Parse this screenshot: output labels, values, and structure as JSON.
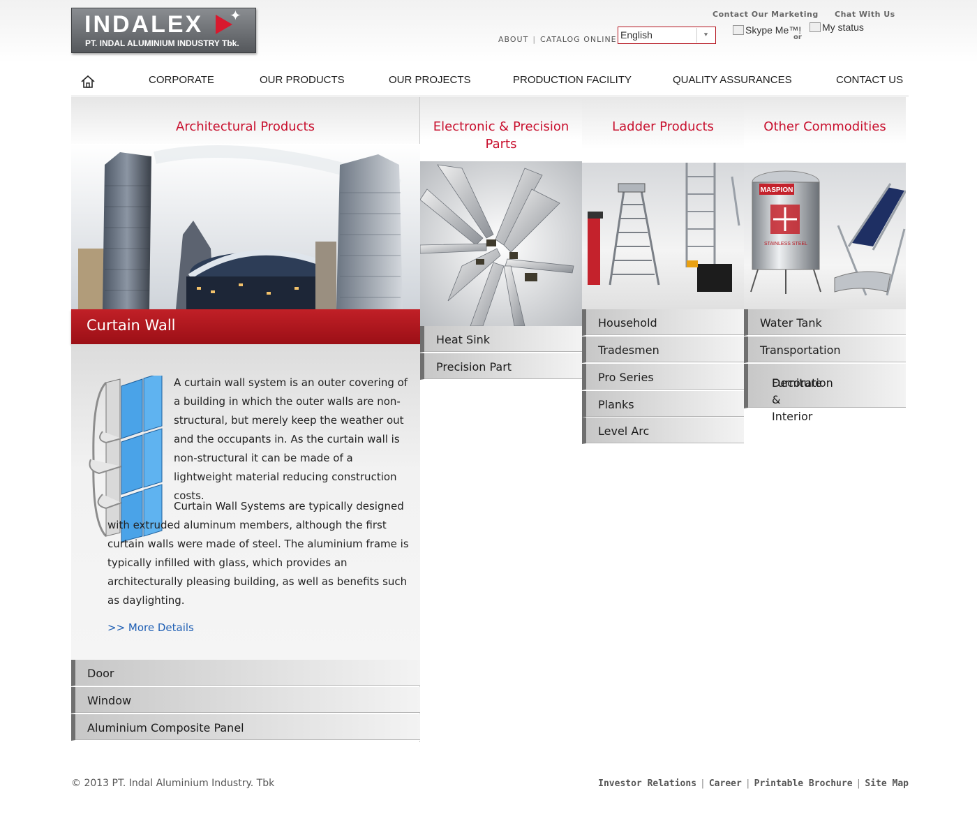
{
  "brand": {
    "logo_word": "INDALEX",
    "logo_sub": "PT. INDAL ALUMINIUM INDUSTRY Tbk."
  },
  "header": {
    "links": [
      "ABOUT",
      "CATALOG ONLINE"
    ],
    "language": "English",
    "contact_marketing": "Contact Our Marketing",
    "chat_with_us": "Chat With Us",
    "skype_alt": "Skype Me™!",
    "skype_or": "or",
    "status_alt": "My status"
  },
  "nav": {
    "home_icon": "home-icon",
    "items": [
      "CORPORATE",
      "OUR PRODUCTS",
      "OUR PROJECTS",
      "PRODUCTION FACILITY",
      "QUALITY ASSURANCES",
      "CONTACT US"
    ]
  },
  "architectural": {
    "title": "Architectural Products",
    "featured": "Curtain Wall",
    "para1": "A curtain wall system is an outer covering of a building in which the outer walls are non-structural, but merely keep the weather out and the occupants in. As the curtain wall is non-structural it can be made of a lightweight material reducing construction costs.",
    "para2": "Curtain Wall Systems are typically designed with extruded aluminum members, although the first curtain walls were made of steel. The aluminium frame is typically infilled with glass, which provides an architecturally pleasing building, as well as benefits such as daylighting.",
    "more": ">> More Details",
    "items": [
      "Door",
      "Window",
      "Aluminium Composite Panel"
    ]
  },
  "electronic": {
    "title_line1": "Electronic & Precision",
    "title_line2": "Parts",
    "items": [
      "Heat Sink",
      "Precision Part"
    ]
  },
  "ladder": {
    "title": "Ladder Products",
    "items": [
      "Household",
      "Tradesmen",
      "Pro Series",
      "Planks",
      "Level Arc"
    ]
  },
  "other": {
    "title": "Other Commodities",
    "tank_brand": "MASPION",
    "tank_label": "STAINLESS STEEL",
    "items": [
      "Water Tank",
      "Transportation",
      "Furniture & Interior",
      "Decoration"
    ]
  },
  "footer": {
    "copyright": "© 2013 PT. Indal Aluminium Industry. Tbk",
    "links": [
      "Investor Relations",
      "Career",
      "Printable Brochure",
      "Site Map"
    ]
  },
  "colors": {
    "accent": "#c8102e",
    "banner": "#b0161f",
    "link": "#1f5fb4"
  }
}
